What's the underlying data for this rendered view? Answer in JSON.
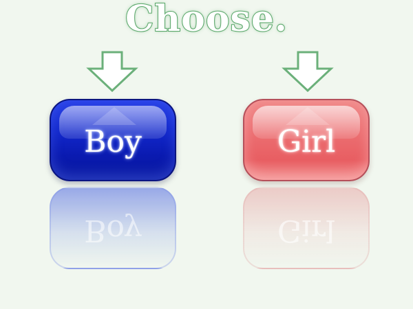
{
  "title": "Choose.",
  "choices": {
    "boy": {
      "label": "Boy",
      "color": "#1228cc"
    },
    "girl": {
      "label": "Girl",
      "color": "#ec6f72"
    }
  },
  "icons": {
    "arrow": "down-arrow-outline",
    "arrow_color": "#5aa86a"
  },
  "background_color": "#f1f7ef"
}
